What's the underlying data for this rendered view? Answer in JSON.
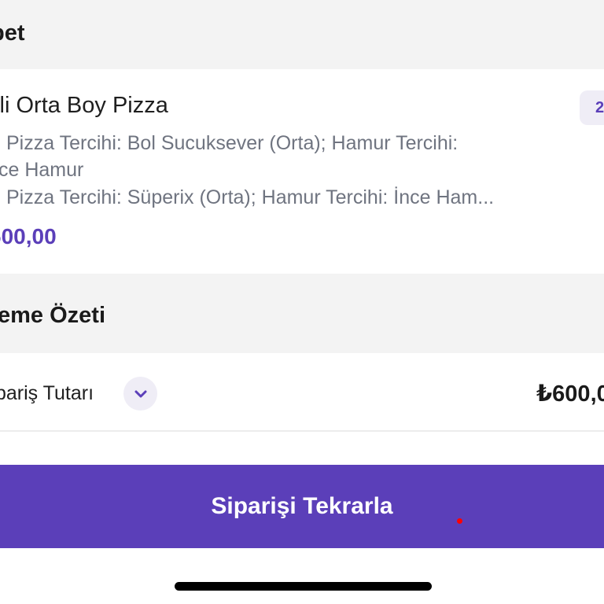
{
  "basket": {
    "title": "pet"
  },
  "product": {
    "name": "'li Orta Boy Pizza",
    "quantity": "2",
    "option_line_1": "Pizza Tercihi: Bol Sucuksever (Orta); Hamur Tercihi:",
    "option_line_2": "ce Hamur",
    "option_line_3": "Pizza Tercihi: Süperix (Orta); Hamur Tercihi: İnce Ham...",
    "price": "600,00"
  },
  "summary": {
    "title": "eme Özeti",
    "row_label": "pariş Tutarı",
    "row_value": "₺600,0"
  },
  "actions": {
    "repeat_label": "Siparişi Tekrarla"
  },
  "icons": {
    "expand": "chevron-down-icon"
  },
  "colors": {
    "accent": "#5b3fb9",
    "accent_light": "#efedf6",
    "section_bg": "#f3f3f3",
    "muted_text": "#6f7480",
    "touch_indicator": "#ff0000"
  }
}
